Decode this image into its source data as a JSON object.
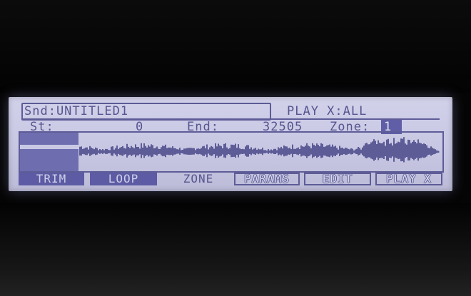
{
  "header": {
    "sound_label": "Snd:UNTITLED1",
    "play_mode": "PLAY X:ALL"
  },
  "status": {
    "start_label": "St:",
    "start_value": "0",
    "end_label": "End:",
    "end_value": "32505",
    "zone_label": "Zone:",
    "zone_value": "1"
  },
  "softkeys": [
    {
      "label": "TRIM"
    },
    {
      "label": "LOOP"
    },
    {
      "label": "ZONE"
    },
    {
      "label": "PARAMS"
    },
    {
      "label": "EDIT"
    },
    {
      "label": "PLAY X"
    }
  ],
  "colors": {
    "lcd_background": "#cbcae5",
    "lcd_ink": "#5d5c97"
  }
}
